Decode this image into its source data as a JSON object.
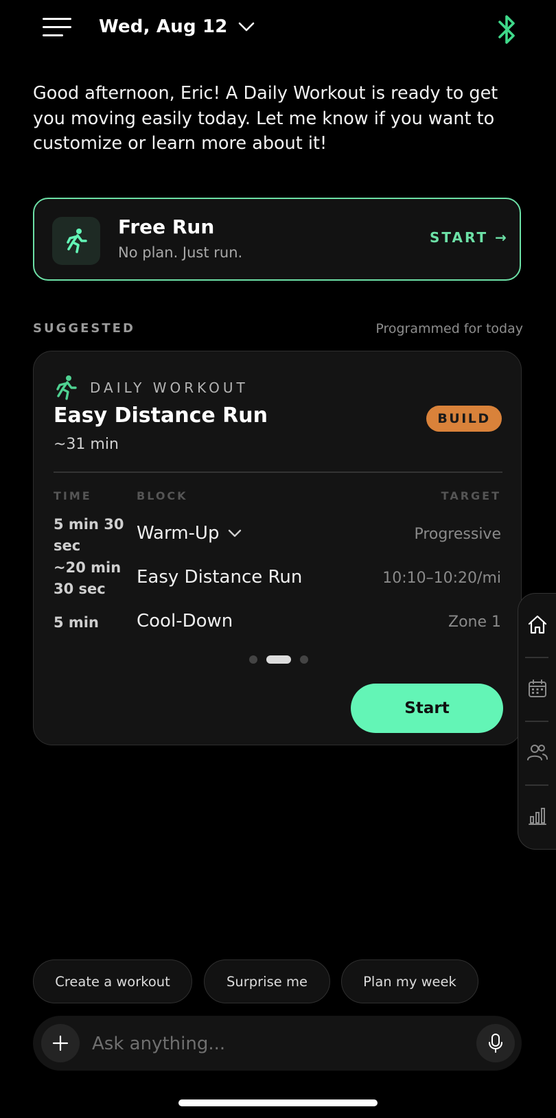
{
  "header": {
    "date_label": "Wed, Aug 12",
    "icons": [
      "menu-icon",
      "chevron-down-icon",
      "bluetooth-icon"
    ]
  },
  "greeting": "Good afternoon, Eric! A Daily Workout is ready to get you moving easily today. Let me know if you want to customize or learn more about it!",
  "free_run": {
    "title": "Free Run",
    "subtitle": "No plan. Just run.",
    "action": "START →",
    "icon": "runner-icon"
  },
  "suggested": {
    "heading": "SUGGESTED",
    "note": "Programmed for today"
  },
  "workout_card": {
    "category": "DAILY WORKOUT",
    "title": "Easy Distance Run",
    "duration": "~31 min",
    "badge": "BUILD",
    "columns": {
      "time": "TIME",
      "block": "BLOCK",
      "target": "TARGET"
    },
    "rows": [
      {
        "time": "5 min 30 sec",
        "block": "Warm-Up",
        "target": "Progressive",
        "expandable": true
      },
      {
        "time": "~20 min 30 sec",
        "block": "Easy Distance Run",
        "target": "10:10–10:20/mi",
        "expandable": false
      },
      {
        "time": "5 min",
        "block": "Cool-Down",
        "target": "Zone 1",
        "expandable": false
      }
    ],
    "pager": {
      "count": 3,
      "active_index": 1
    },
    "start_label": "Start"
  },
  "dock": {
    "items": [
      "home-icon",
      "calendar-icon",
      "people-icon",
      "stats-icon"
    ]
  },
  "chips": [
    "Create a workout",
    "Surprise me",
    "Plan my week"
  ],
  "input": {
    "placeholder": "Ask anything..."
  },
  "colors": {
    "accent_green": "#6ce0a6",
    "start_button": "#63f5b6",
    "badge_orange": "#d9823a",
    "background": "#000000",
    "card": "#141414"
  }
}
